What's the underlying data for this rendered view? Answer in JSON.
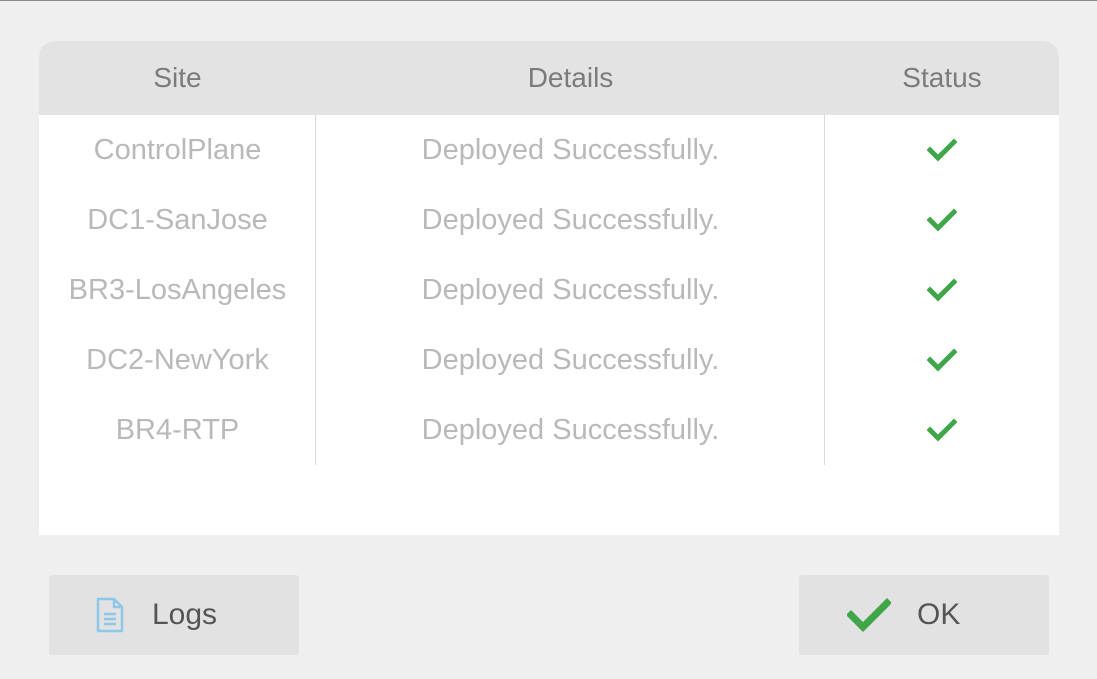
{
  "table": {
    "headers": {
      "site": "Site",
      "details": "Details",
      "status": "Status"
    },
    "rows": [
      {
        "site": "ControlPlane",
        "details": "Deployed Successfully.",
        "status_icon": "checkmark-icon"
      },
      {
        "site": "DC1-SanJose",
        "details": "Deployed Successfully.",
        "status_icon": "checkmark-icon"
      },
      {
        "site": "BR3-LosAngeles",
        "details": "Deployed Successfully.",
        "status_icon": "checkmark-icon"
      },
      {
        "site": "DC2-NewYork",
        "details": "Deployed Successfully.",
        "status_icon": "checkmark-icon"
      },
      {
        "site": "BR4-RTP",
        "details": "Deployed Successfully.",
        "status_icon": "checkmark-icon"
      }
    ]
  },
  "buttons": {
    "logs": {
      "label": "Logs",
      "icon": "document-icon"
    },
    "ok": {
      "label": "OK",
      "icon": "checkmark-icon"
    }
  },
  "colors": {
    "success": "#3fa64a",
    "doc_icon": "#8ec7e8",
    "header_bg": "#e3e3e3",
    "page_bg": "#efefef"
  }
}
